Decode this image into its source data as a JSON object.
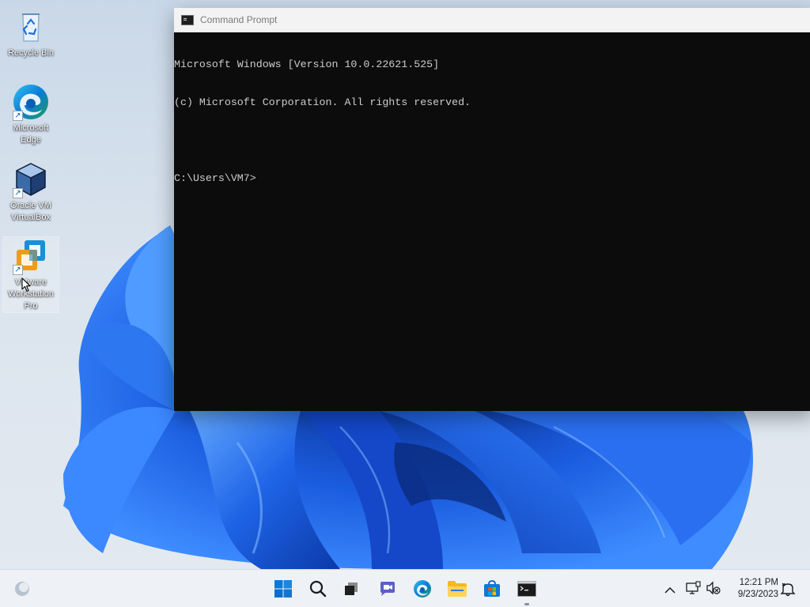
{
  "desktop": {
    "icons": [
      {
        "label": "Recycle Bin",
        "icon": "recycle-bin-icon"
      },
      {
        "label": "Microsoft\nEdge",
        "icon": "edge-icon",
        "shortcut": true
      },
      {
        "label": "Oracle VM\nVirtualBox",
        "icon": "virtualbox-icon",
        "shortcut": true
      },
      {
        "label": "VMware\nWorkstation\nPro",
        "icon": "vmware-icon",
        "shortcut": true,
        "selected": true
      }
    ],
    "wallpaper": "windows-11-bloom"
  },
  "cmd": {
    "title": "Command Prompt",
    "lines": [
      "Microsoft Windows [Version 10.0.22621.525]",
      "(c) Microsoft Corporation. All rights reserved.",
      "",
      "C:\\Users\\VM7>"
    ],
    "colors": {
      "background": "#0c0c0c",
      "text": "#cccccc"
    }
  },
  "taskbar": {
    "pinned": [
      {
        "name": "start",
        "icon": "windows-start-icon"
      },
      {
        "name": "search",
        "icon": "search-icon"
      },
      {
        "name": "task-view",
        "icon": "task-view-icon"
      },
      {
        "name": "chat",
        "icon": "teams-chat-icon"
      },
      {
        "name": "edge",
        "icon": "edge-icon"
      },
      {
        "name": "file-explorer",
        "icon": "folder-icon"
      },
      {
        "name": "microsoft-store",
        "icon": "store-icon"
      },
      {
        "name": "command-prompt",
        "icon": "cmd-icon",
        "active": true
      }
    ],
    "tray": {
      "icons": [
        "chevron-up-icon",
        "network-icon",
        "volume-muted-icon",
        "notification-icon"
      ],
      "time": "12:21 PM",
      "date": "9/23/2023"
    },
    "colors": {
      "accent": "#0067c0"
    }
  }
}
